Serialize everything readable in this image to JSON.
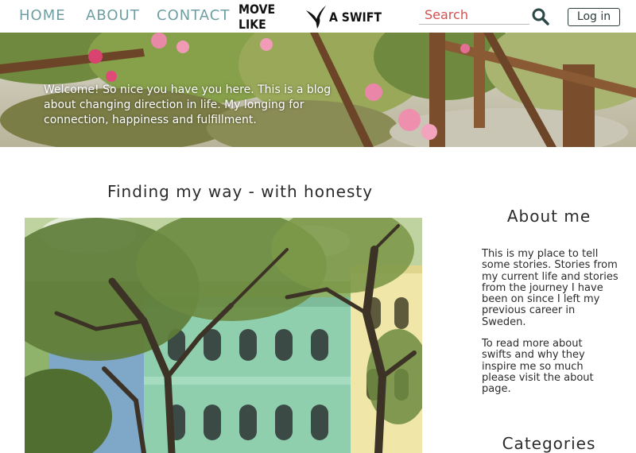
{
  "nav": {
    "home": "HOME",
    "about": "ABOUT",
    "contact": "CONTACT"
  },
  "logo": {
    "left_text": "MOVE LIKE",
    "right_text": "A SWIFT",
    "icon": "swift-bird-icon"
  },
  "search": {
    "placeholder": "Search",
    "icon": "search-icon"
  },
  "login": {
    "label": "Log in"
  },
  "hero": {
    "welcome_text": "Welcome! So nice you have you here. This is a blog about changing direction in life. My longing for connection, happiness and fulfillment."
  },
  "post": {
    "title": "Finding my way - with honesty"
  },
  "sidebar": {
    "about_title": "About me",
    "about_p1": "This is my place to tell some stories. Stories from my current life and stories from the journey I have been on since I left my previous career in Sweden.",
    "about_p2": "To read more about swifts and why they inspire me so much please visit the about page.",
    "categories_title": "Categories"
  },
  "colors": {
    "nav_link": "#6f9ea3",
    "search_placeholder": "#d35050",
    "text": "#2b2b2b"
  }
}
